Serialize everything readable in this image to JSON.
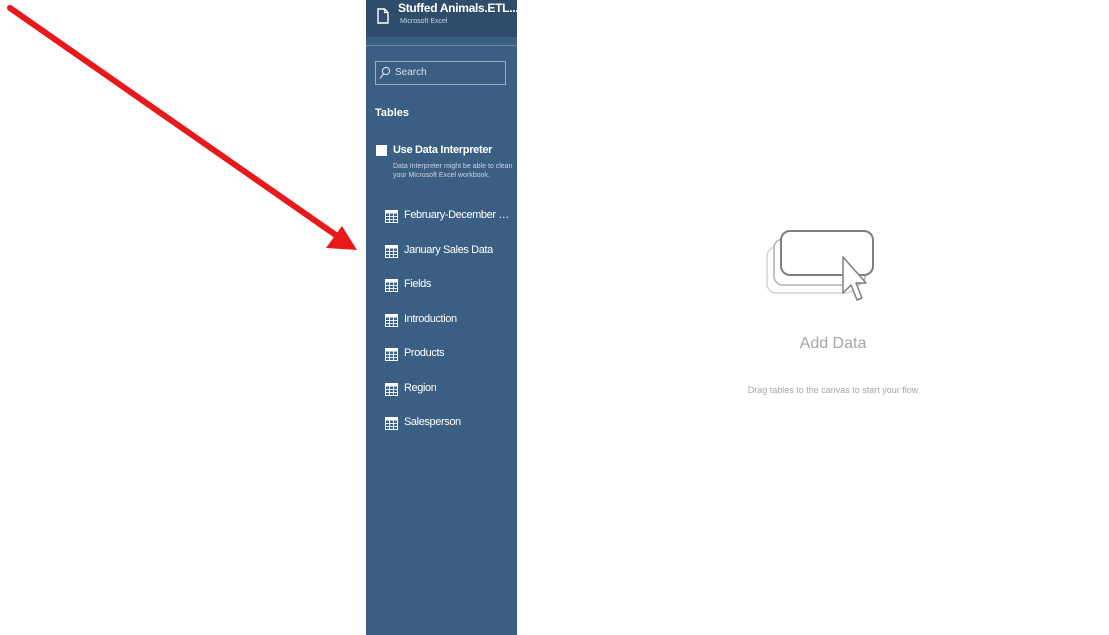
{
  "connection": {
    "name": "Stuffed Animals.ETL....",
    "type": "Microsoft Excel"
  },
  "search": {
    "placeholder": "Search"
  },
  "tables_heading": "Tables",
  "data_interpreter": {
    "label": "Use Data Interpreter",
    "description": "Data Interpreter might be able to clean your Microsoft Excel workbook.",
    "checked": false
  },
  "tables": [
    {
      "label": "February-December S..."
    },
    {
      "label": "January Sales Data"
    },
    {
      "label": "Fields"
    },
    {
      "label": "Introduction"
    },
    {
      "label": "Products"
    },
    {
      "label": "Region"
    },
    {
      "label": "Salesperson"
    }
  ],
  "canvas": {
    "title": "Add Data",
    "hint": "Drag tables to the canvas to start your flow"
  },
  "colors": {
    "sidebar_bg": "#3b5f82",
    "arrow": "#e8191a"
  },
  "icons": {
    "connection": "file-icon",
    "search": "search-icon",
    "table": "table-grid-icon",
    "add_data": "add-data-icon",
    "annotation": "red-arrow-icon"
  }
}
